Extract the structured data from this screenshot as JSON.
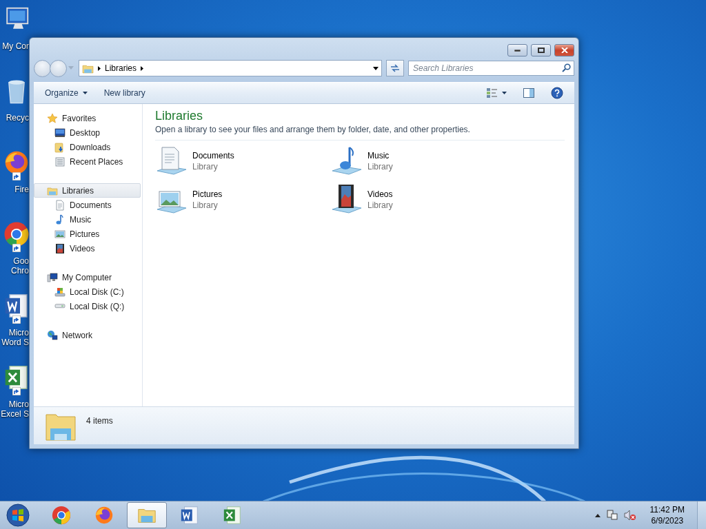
{
  "desktop_icons": [
    {
      "kind": "computer",
      "shortcut": false,
      "label_lines": [
        "My Cor"
      ]
    },
    {
      "kind": "recycle",
      "shortcut": false,
      "label_lines": [
        "Recyc"
      ]
    },
    {
      "kind": "firefox",
      "shortcut": true,
      "label_lines": [
        "Fire"
      ]
    },
    {
      "kind": "chrome",
      "shortcut": true,
      "label_lines": [
        "Goo",
        "Chro"
      ]
    },
    {
      "kind": "word",
      "shortcut": true,
      "label_lines": [
        "Micro",
        "Word S"
      ]
    },
    {
      "kind": "excel",
      "shortcut": true,
      "label_lines": [
        "Micro",
        "Excel S"
      ]
    }
  ],
  "window": {
    "address": {
      "crumbs": [
        "Libraries"
      ]
    },
    "search": {
      "placeholder": "Search Libraries"
    },
    "toolbar": [
      {
        "label": "Organize",
        "dropdown": true
      },
      {
        "label": "New library",
        "dropdown": false
      }
    ],
    "nav": [
      {
        "label": "Favorites",
        "kind": "star",
        "selected": false,
        "children": [
          {
            "label": "Desktop",
            "kind": "desktop",
            "selected": false
          },
          {
            "label": "Downloads",
            "kind": "downloads",
            "selected": false
          },
          {
            "label": "Recent Places",
            "kind": "recent",
            "selected": false
          }
        ]
      },
      {
        "label": "Libraries",
        "kind": "libraries",
        "selected": true,
        "children": [
          {
            "label": "Documents",
            "kind": "documents",
            "selected": false
          },
          {
            "label": "Music",
            "kind": "music",
            "selected": false
          },
          {
            "label": "Pictures",
            "kind": "pictures",
            "selected": false
          },
          {
            "label": "Videos",
            "kind": "videos",
            "selected": false
          }
        ]
      },
      {
        "label": "My Computer",
        "kind": "computer",
        "selected": false,
        "children": [
          {
            "label": "Local Disk (C:)",
            "kind": "systemdisk",
            "selected": false
          },
          {
            "label": "Local Disk (Q:)",
            "kind": "disk",
            "selected": false
          }
        ]
      },
      {
        "label": "Network",
        "kind": "network",
        "selected": false
      }
    ],
    "content": {
      "title": "Libraries",
      "description": "Open a library to see your files and arrange them by folder, date, and other properties.",
      "items": [
        {
          "name": "Documents",
          "type": "Library",
          "kind": "documents"
        },
        {
          "name": "Music",
          "type": "Library",
          "kind": "music"
        },
        {
          "name": "Pictures",
          "type": "Library",
          "kind": "pictures"
        },
        {
          "name": "Videos",
          "type": "Library",
          "kind": "videos"
        }
      ]
    },
    "status": {
      "count": "4 items"
    }
  },
  "taskbar": {
    "apps": [
      {
        "kind": "chrome",
        "active": false
      },
      {
        "kind": "firefox",
        "active": false
      },
      {
        "kind": "explorer",
        "active": true
      },
      {
        "kind": "word",
        "active": false
      },
      {
        "kind": "excel",
        "active": false
      }
    ],
    "clock": {
      "time": "11:42 PM",
      "date": "6/9/2023"
    }
  }
}
